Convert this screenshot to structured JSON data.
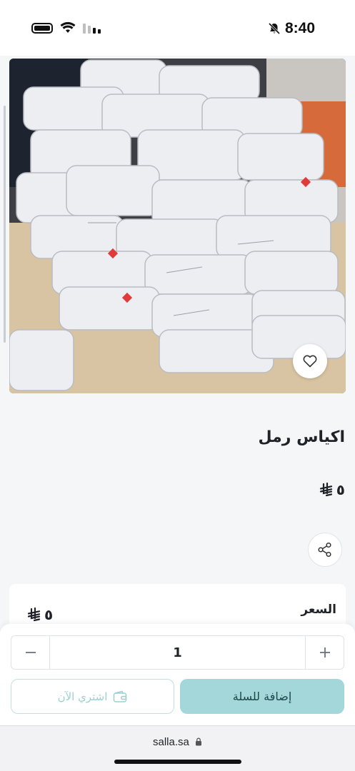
{
  "status_bar": {
    "time": "8:40",
    "icons": [
      "battery-icon",
      "wifi-icon",
      "cellular-signal-icon",
      "silent-bell-icon"
    ]
  },
  "product": {
    "title": "اكياس رمل",
    "price": "٥",
    "currency_icon": "riyal-symbol-icon"
  },
  "price_card": {
    "label": "السعر",
    "value": "٥"
  },
  "cart": {
    "quantity": "1",
    "add_to_cart_label": "إضافة للسلة",
    "buy_now_label": "اشتري الآن"
  },
  "browser": {
    "url": "salla.sa"
  },
  "colors": {
    "accent": "#a3d7d9",
    "accent_text": "#1e4446",
    "outline": "#bfe0e1"
  }
}
